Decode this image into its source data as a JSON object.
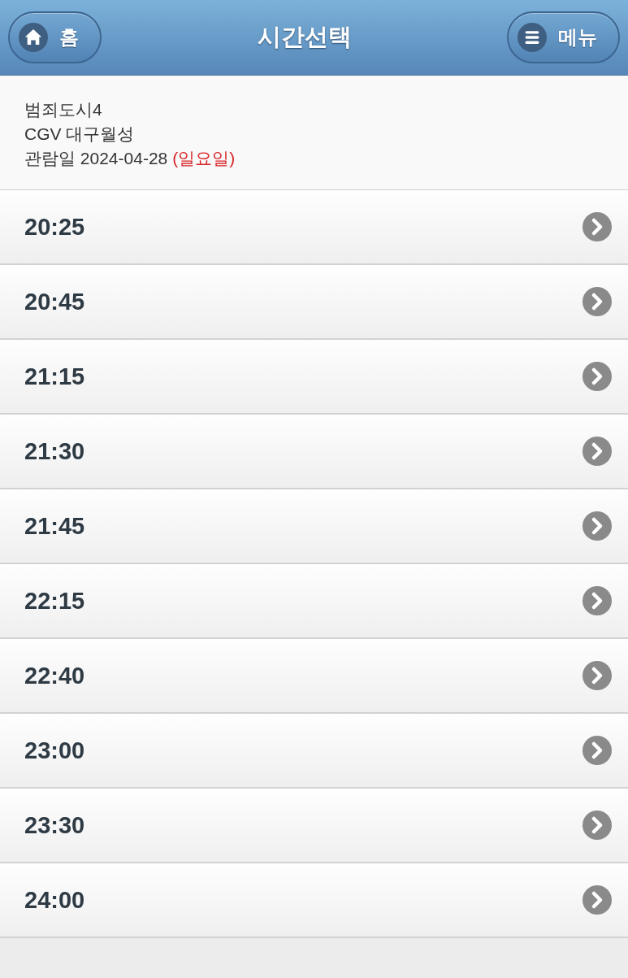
{
  "header": {
    "title": "시간선택",
    "home_button": "홈",
    "menu_button": "메뉴"
  },
  "info": {
    "movie": "범죄도시4",
    "theater": "CGV 대구월성",
    "date": "관람일 2024-04-28",
    "weekday": "(일요일)"
  },
  "showtimes": [
    {
      "time": "20:25"
    },
    {
      "time": "20:45"
    },
    {
      "time": "21:15"
    },
    {
      "time": "21:30"
    },
    {
      "time": "21:45"
    },
    {
      "time": "22:15"
    },
    {
      "time": "22:40"
    },
    {
      "time": "23:00"
    },
    {
      "time": "23:30"
    },
    {
      "time": "24:00"
    }
  ]
}
